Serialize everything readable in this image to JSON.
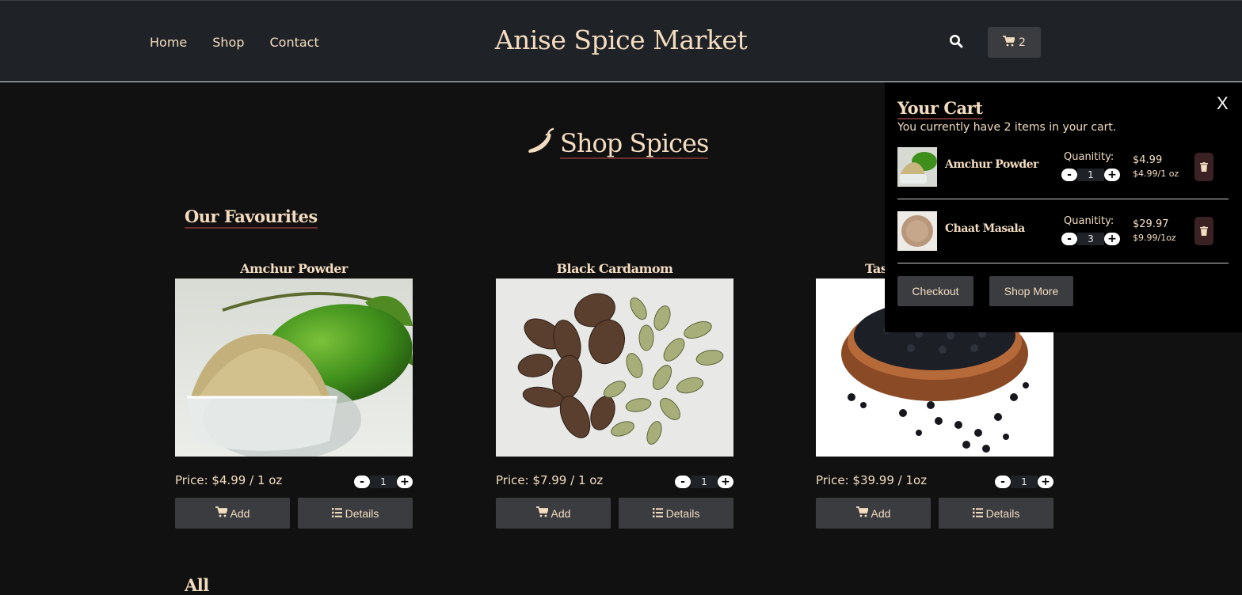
{
  "header": {
    "nav": [
      "Home",
      "Shop",
      "Contact"
    ],
    "title": "Anise Spice Market",
    "cart_count": "2"
  },
  "page": {
    "heading": "Shop Spices",
    "favourites_title": "Our Favourites",
    "all_title": "All"
  },
  "products": [
    {
      "name": "Amchur Powder",
      "price": "Price: $4.99 / 1 oz",
      "qty": "1",
      "add_label": "Add",
      "details_label": "Details",
      "image": "amchur-powder-photo"
    },
    {
      "name": "Black Cardamom",
      "price": "Price: $7.99 / 1 oz",
      "qty": "1",
      "add_label": "Add",
      "details_label": "Details",
      "image": "cardamom-pods-photo"
    },
    {
      "name": "Tas",
      "price": "Price: $39.99 / 1oz",
      "qty": "1",
      "add_label": "Add",
      "details_label": "Details",
      "image": "black-seeds-bowl-photo"
    }
  ],
  "cart": {
    "title": "Your Cart",
    "close_label": "X",
    "summary": "You currently have 2 items in your cart.",
    "quantity_label": "Quanitity:",
    "items": [
      {
        "name": "Amchur Powder",
        "qty": "1",
        "total": "$4.99",
        "unit": "$4.99/1 oz"
      },
      {
        "name": "Chaat Masala",
        "qty": "3",
        "total": "$29.97",
        "unit": "$9.99/1oz"
      }
    ],
    "checkout_label": "Checkout",
    "shop_more_label": "Shop More"
  },
  "colors": {
    "background": "#111111",
    "header": "#1f2226",
    "text_accent": "#f3dcc0",
    "button": "#3a3c40",
    "underline": "#6b2f2f"
  }
}
